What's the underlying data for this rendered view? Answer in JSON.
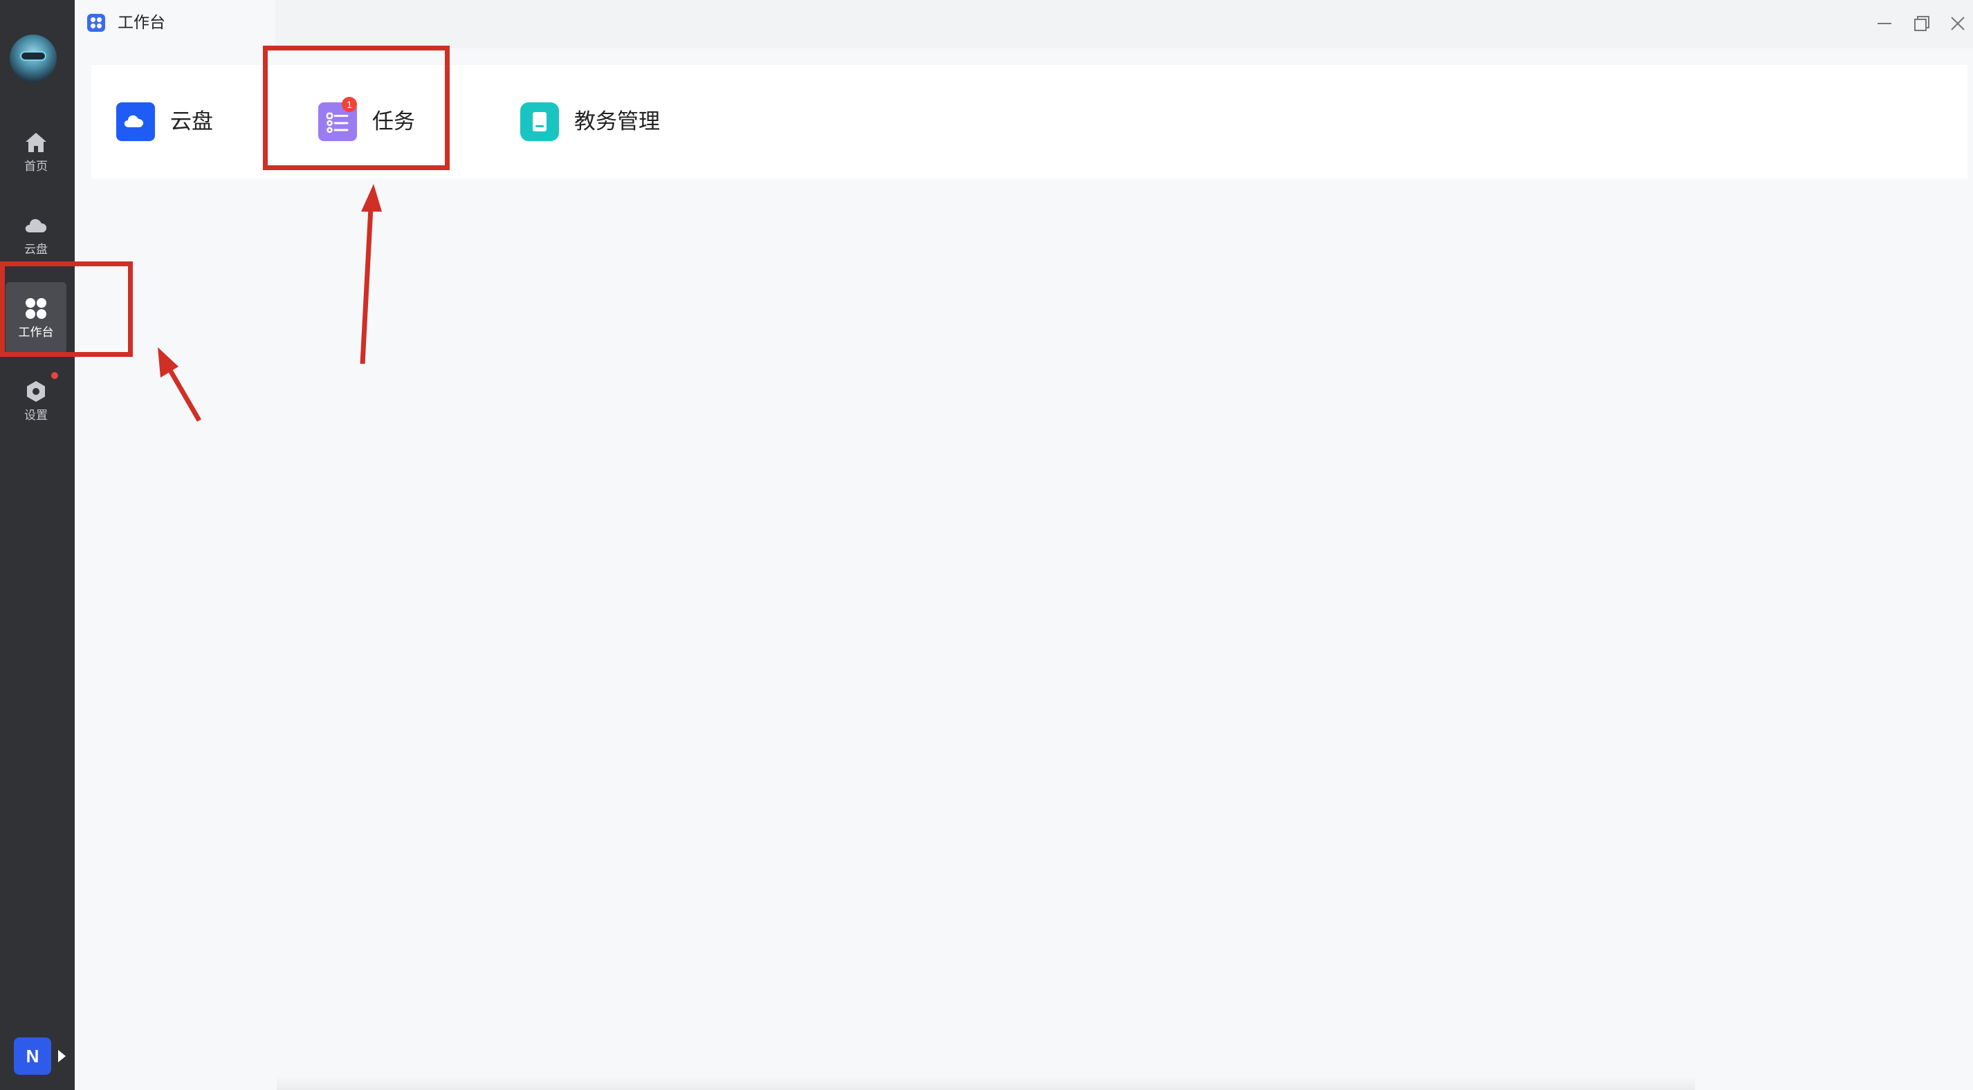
{
  "window": {
    "tab_title": "工作台",
    "controls": [
      "minimize-icon",
      "restore-icon",
      "close-icon"
    ]
  },
  "sidebar": {
    "avatar": "user-avatar",
    "items": [
      {
        "label": "首页",
        "icon": "home-icon",
        "active": false
      },
      {
        "label": "云盘",
        "icon": "cloud-icon",
        "active": false
      },
      {
        "label": "工作台",
        "icon": "grid-icon",
        "active": true
      },
      {
        "label": "设置",
        "icon": "gear-icon",
        "active": false,
        "notification_dot": true
      }
    ],
    "bottom_badge": "N"
  },
  "apps": [
    {
      "label": "云盘",
      "icon": "cloud-icon",
      "color": "#1f5bf5"
    },
    {
      "label": "任务",
      "icon": "task-list-icon",
      "color": "#9a7cf2",
      "badge": "1"
    },
    {
      "label": "教务管理",
      "icon": "book-icon",
      "color": "#19c5c0"
    }
  ],
  "colors": {
    "sidebar_bg": "#303236",
    "annotation": "#cf2f25",
    "accent": "#3a6cf0"
  }
}
